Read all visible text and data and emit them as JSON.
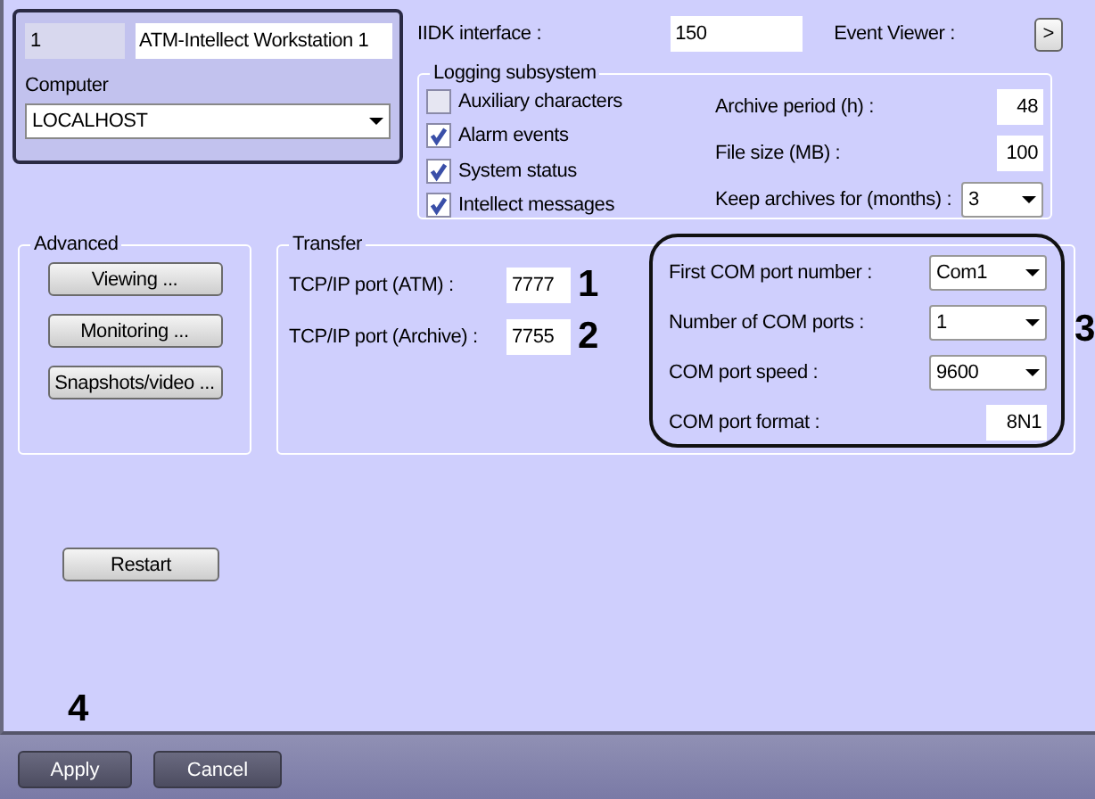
{
  "workstation": {
    "id": "1",
    "name": "ATM-Intellect Workstation 1",
    "computer_label": "Computer",
    "computer": "LOCALHOST"
  },
  "iidk": {
    "label": "IIDK interface :",
    "value": "150"
  },
  "event_viewer": {
    "label": "Event Viewer :",
    "button": ">"
  },
  "logging": {
    "title": "Logging subsystem",
    "options": [
      {
        "label": "Auxiliary characters",
        "checked": false
      },
      {
        "label": "Alarm events",
        "checked": true
      },
      {
        "label": "System status",
        "checked": true
      },
      {
        "label": "Intellect messages",
        "checked": true
      }
    ],
    "settings": [
      {
        "kind": "input",
        "label": "Archive period (h) :",
        "value": "48"
      },
      {
        "kind": "input",
        "label": "File size (MB) :",
        "value": "100"
      },
      {
        "kind": "select",
        "label": "Keep archives for (months) :",
        "value": "3"
      }
    ]
  },
  "advanced": {
    "title": "Advanced",
    "buttons": [
      "Viewing ...",
      "Monitoring ...",
      "Snapshots/video ..."
    ]
  },
  "transfer": {
    "title": "Transfer",
    "ports": [
      {
        "label": "TCP/IP port (ATM) :",
        "value": "7777",
        "callout": "1"
      },
      {
        "label": "TCP/IP port (Archive) :",
        "value": "7755",
        "callout": "2"
      }
    ],
    "com": [
      {
        "kind": "select",
        "label": "First COM port number :",
        "value": "Com1"
      },
      {
        "kind": "select",
        "label": "Number of COM ports :",
        "value": "1"
      },
      {
        "kind": "select",
        "label": "COM port speed :",
        "value": "9600"
      },
      {
        "kind": "input",
        "label": "COM port format :",
        "value": "8N1"
      }
    ],
    "com_callout": "3"
  },
  "restart": "Restart",
  "footer": {
    "buttons": [
      "Apply",
      "Cancel"
    ],
    "callout": "4"
  }
}
